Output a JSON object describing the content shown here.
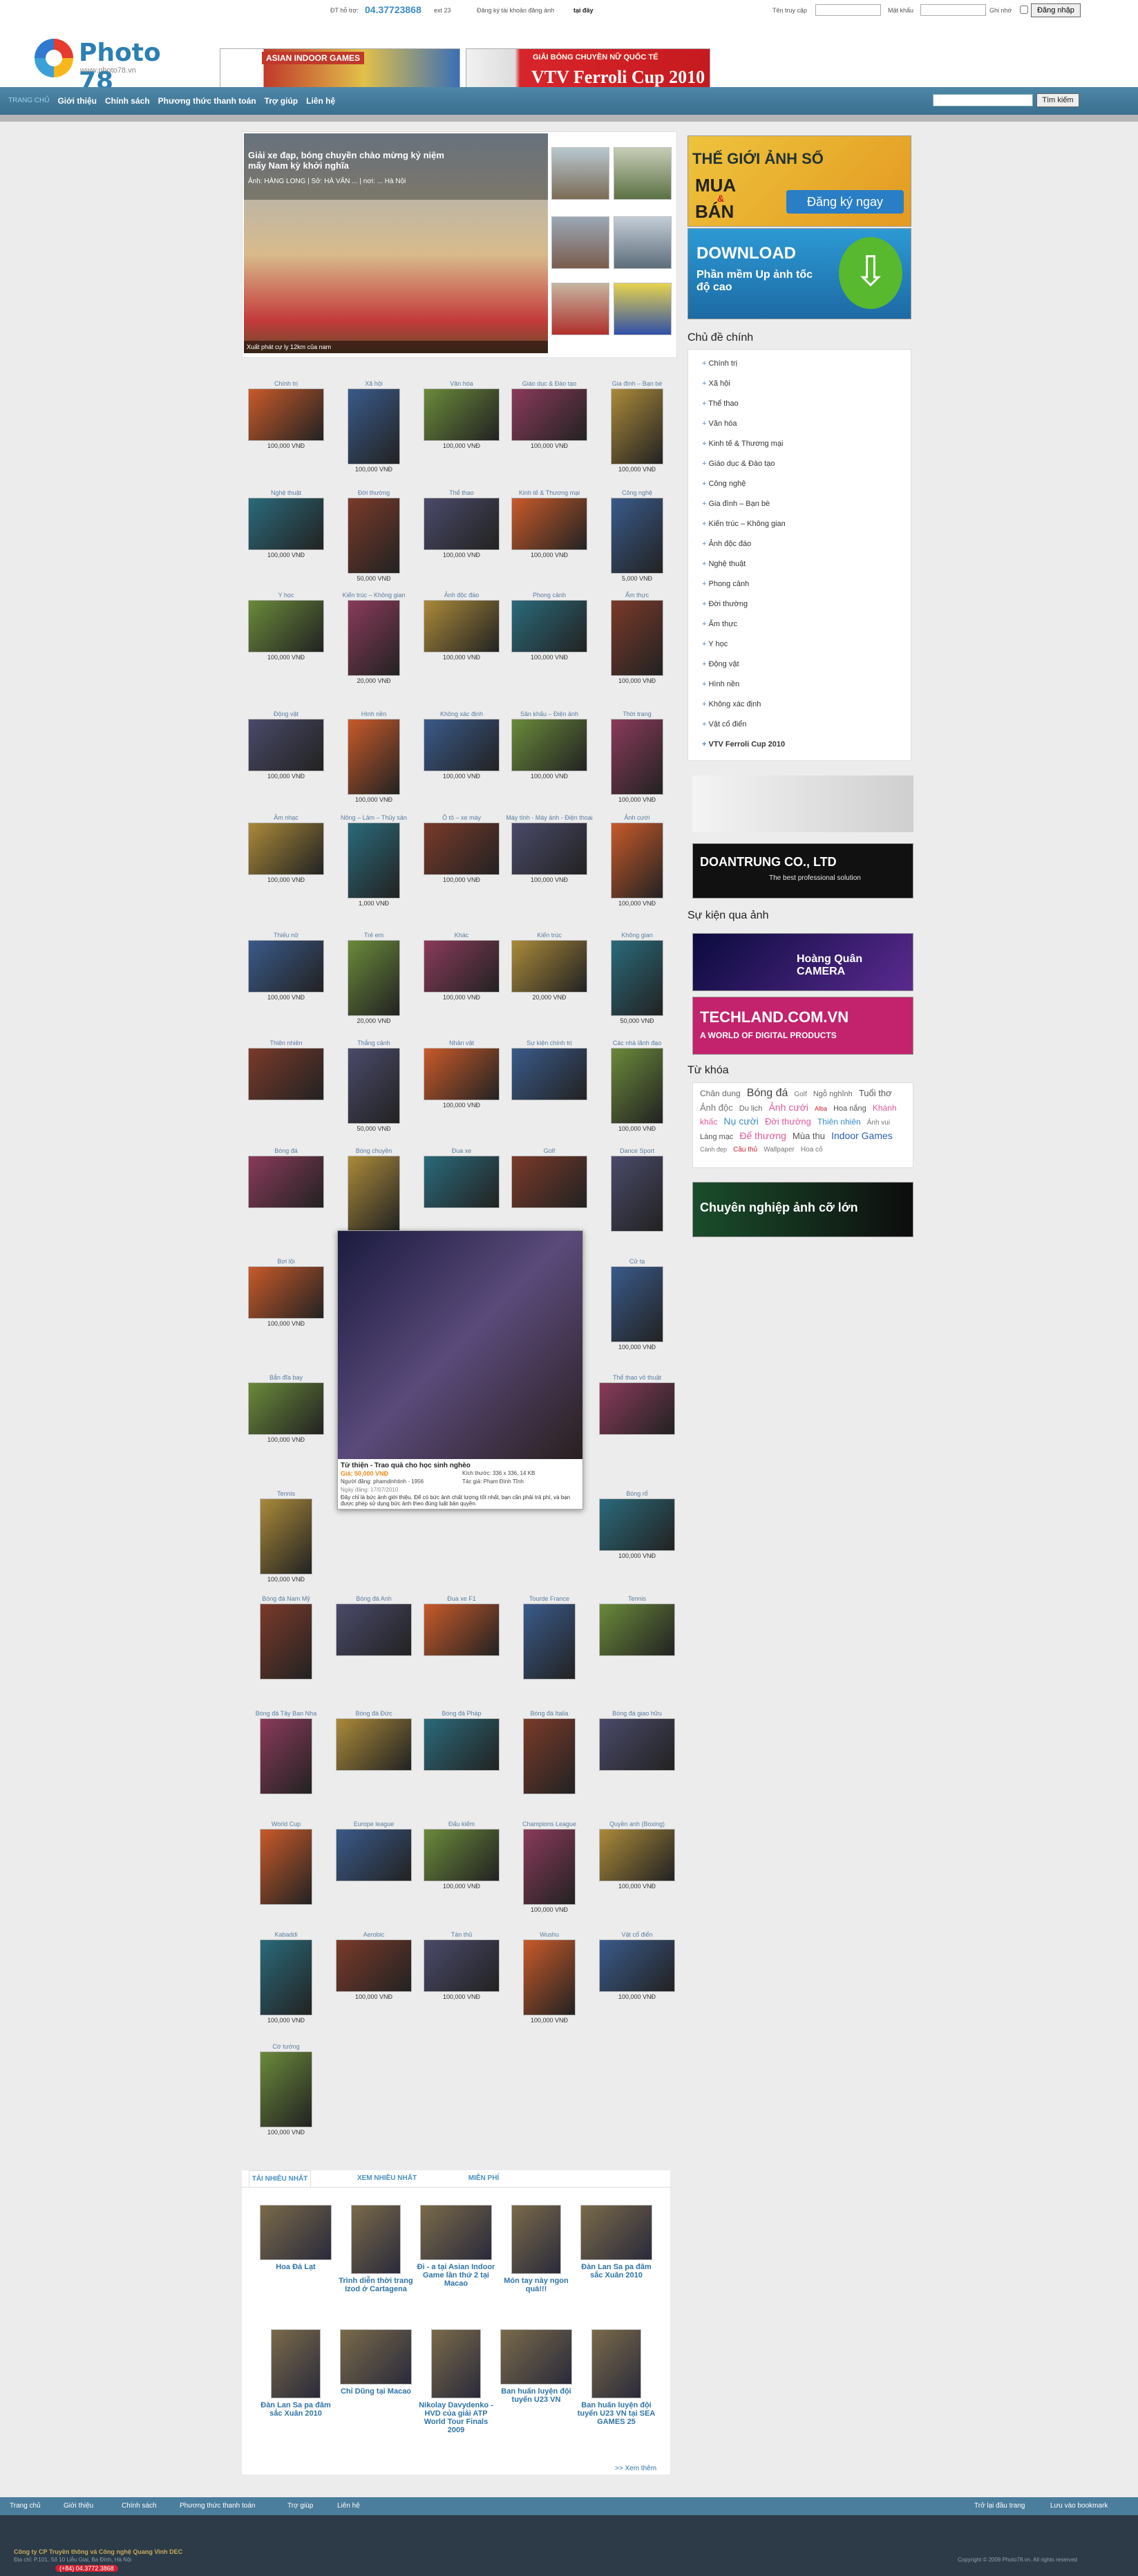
{
  "topbar": {
    "hotline_label": "ĐT hỗ trợ:",
    "hotline": "04.37723868",
    "ext": "ext 23",
    "register": "Đăng ký tài khoản đăng ảnh",
    "register_here": "tại đây",
    "login_label": "Tên truy cập",
    "password_label": "Mật khẩu",
    "remember": "Ghi nhớ",
    "login_button": "Đăng nhập"
  },
  "logo": {
    "name": "Photo 78",
    "url": "www.photo78.vn"
  },
  "banners": {
    "left": "ASIAN INDOOR GAMES",
    "right_top": "GIẢI BÓNG CHUYỀN NỮ QUỐC TẾ",
    "right_main": "VTV Ferroli Cup 2010"
  },
  "nav": {
    "first": "TRANG CHỦ",
    "items": [
      "Giới thiệu",
      "Chính sách",
      "Phương thức thanh toán",
      "Trợ giúp",
      "Liên hệ"
    ],
    "search_button": "Tìm kiếm"
  },
  "featured": {
    "title": "Giải xe đạp, bóng chuyền chào mừng kỷ niệm mấy Nam kỳ khởi nghĩa",
    "sub": "Ảnh: HÀNG LONG | Sở: HÀ VĂN ... | nơi: ... Hà Nội",
    "caption": "Xuất phát cự ly 12km của nam"
  },
  "ads": {
    "world_title": "THẾ GIỚI ẢNH SỐ",
    "buy": "MUA",
    "and": "&",
    "sell": "BÁN",
    "register": "Đăng ký ngay",
    "download": "DOWNLOAD",
    "software": "Phần mềm Up ảnh tốc độ cao",
    "doantrung": "DOANTRUNG CO., LTD",
    "doantrung_sub": "The best professional solution",
    "hoangquan": "Hoàng Quân CAMERA",
    "techland": "TECHLAND.COM.VN",
    "techland_sub": "A WORLD OF DIGITAL PRODUCTS",
    "career": "Chuyên nghiệp ảnh cỡ lớn"
  },
  "sidebar": {
    "topics_title": "Chủ đề chính",
    "topics": [
      "Chính trị",
      "Xã hội",
      "Thể thao",
      "Văn hóa",
      "Kinh tế & Thương mại",
      "Giáo dục & Đào tạo",
      "Công nghệ",
      "Gia đình – Bạn bè",
      "Kiến trúc – Không gian",
      "Ảnh độc đáo",
      "Nghệ thuật",
      "Phong cảnh",
      "Đời thường",
      "Ẩm thực",
      "Y học",
      "Động vật",
      "Hình nền",
      "Không xác định",
      "Vật cổ điển",
      "VTV Ferroli Cup 2010"
    ],
    "events_title": "Sự kiện qua ảnh",
    "tags_title": "Từ khóa",
    "tags": [
      "Chân dung",
      "Bóng đá",
      "Golf",
      "Ngỗ nghĩnh",
      "Tuổi thơ",
      "Ảnh độc",
      "Du lịch",
      "Ảnh cưới",
      "Alba",
      "Hoa nắng",
      "Khánh khấc",
      "Nụ cười",
      "Đời thường",
      "Thiên nhiên",
      "Ảnh vui",
      "Làng mạc",
      "Để thương",
      "Mùa thu",
      "Indoor Games",
      "Cảnh đẹp",
      "Cầu thủ",
      "Wallpaper",
      "Hoa cỏ"
    ]
  },
  "categories": [
    {
      "label": "Chính trị",
      "price": "100,000 VNĐ"
    },
    {
      "label": "Xã hội",
      "price": "100,000 VNĐ"
    },
    {
      "label": "Văn hóa",
      "price": "100,000 VNĐ"
    },
    {
      "label": "Giáo dục & Đào tạo",
      "price": "100,000 VNĐ"
    },
    {
      "label": "Gia đình – Bạn bè",
      "price": "100,000 VNĐ"
    },
    {
      "label": "Nghệ thuật",
      "price": "100,000 VNĐ"
    },
    {
      "label": "Đời thường",
      "price": "50,000 VNĐ"
    },
    {
      "label": "Thể thao",
      "price": "100,000 VNĐ"
    },
    {
      "label": "Kinh tế & Thương mại",
      "price": "100,000 VNĐ"
    },
    {
      "label": "Công nghệ",
      "price": "5,000 VNĐ"
    },
    {
      "label": "Y học",
      "price": "100,000 VNĐ"
    },
    {
      "label": "Kiến trúc – Không gian",
      "price": "20,000 VNĐ"
    },
    {
      "label": "Ảnh độc đáo",
      "price": "100,000 VNĐ"
    },
    {
      "label": "Phong cảnh",
      "price": "100,000 VNĐ"
    },
    {
      "label": "Ẩm thực",
      "price": "100,000 VNĐ"
    },
    {
      "label": "Động vật",
      "price": "100,000 VNĐ"
    },
    {
      "label": "Hình nền",
      "price": "100,000 VNĐ"
    },
    {
      "label": "Không xác định",
      "price": "100,000 VNĐ"
    },
    {
      "label": "Sân khấu – Điện ảnh",
      "price": "100,000 VNĐ"
    },
    {
      "label": "Thời trang",
      "price": "100,000 VNĐ"
    },
    {
      "label": "Âm nhạc",
      "price": "100,000 VNĐ"
    },
    {
      "label": "Nông – Lâm – Thủy sản",
      "price": "1,000 VNĐ"
    },
    {
      "label": "Ô tô – xe máy",
      "price": "100,000 VNĐ"
    },
    {
      "label": "Máy tính - Máy ảnh - Điện thoại",
      "price": "100,000 VNĐ"
    },
    {
      "label": "Ảnh cưới",
      "price": "100,000 VNĐ"
    },
    {
      "label": "Thiếu nữ",
      "price": "100,000 VNĐ"
    },
    {
      "label": "Trẻ em",
      "price": "20,000 VNĐ"
    },
    {
      "label": "Khác",
      "price": "100,000 VNĐ"
    },
    {
      "label": "Kiến trúc",
      "price": "20,000 VNĐ"
    },
    {
      "label": "Không gian",
      "price": "50,000 VNĐ"
    },
    {
      "label": "Thiên nhiên",
      "price": ""
    },
    {
      "label": "Thắng cảnh",
      "price": "50,000 VNĐ"
    },
    {
      "label": "Nhân vật",
      "price": "100,000 VNĐ"
    },
    {
      "label": "Sự kiện chính trị",
      "price": ""
    },
    {
      "label": "Các nhà lãnh đạo",
      "price": "100,000 VNĐ"
    },
    {
      "label": "Bóng đá",
      "price": ""
    },
    {
      "label": "Bóng chuyền",
      "price": ""
    },
    {
      "label": "Đua xe",
      "price": ""
    },
    {
      "label": "Golf",
      "price": ""
    },
    {
      "label": "Dance Sport",
      "price": ""
    },
    {
      "label": "Bơi lội",
      "price": "100,000 VNĐ"
    },
    {
      "label": "Cử tạ",
      "price": "100,000 VNĐ"
    },
    {
      "label": "Bắn đĩa bay",
      "price": "100,000 VNĐ"
    },
    {
      "label": "Thể thao vô thuật",
      "price": ""
    },
    {
      "label": "Tennis",
      "price": "100,000 VNĐ"
    },
    {
      "label": "Bóng rổ",
      "price": "100,000 VNĐ"
    },
    {
      "label": "Bóng đá Nam Mỹ",
      "price": ""
    },
    {
      "label": "Bóng đá Anh",
      "price": ""
    },
    {
      "label": "Đua xe F1",
      "price": ""
    },
    {
      "label": "Tourde France",
      "price": ""
    },
    {
      "label": "Tennis",
      "price": ""
    },
    {
      "label": "Bóng đá Tây Ban Nha",
      "price": ""
    },
    {
      "label": "Bóng đá Đức",
      "price": ""
    },
    {
      "label": "Bóng đá Pháp",
      "price": ""
    },
    {
      "label": "Bóng đá Italia",
      "price": ""
    },
    {
      "label": "Bóng đá giao hữu",
      "price": ""
    },
    {
      "label": "World Cup",
      "price": ""
    },
    {
      "label": "Europe league",
      "price": ""
    },
    {
      "label": "Đấu kiếm",
      "price": "100,000 VNĐ"
    },
    {
      "label": "Champions League",
      "price": "100,000 VNĐ"
    },
    {
      "label": "Quyền anh (Boxing)",
      "price": "100,000 VNĐ"
    },
    {
      "label": "Kabaddi",
      "price": "100,000 VNĐ"
    },
    {
      "label": "Aerobic",
      "price": "100,000 VNĐ"
    },
    {
      "label": "Tán thủ",
      "price": "100,000 VNĐ"
    },
    {
      "label": "Wushu",
      "price": "100,000 VNĐ"
    },
    {
      "label": "Vật cổ điển",
      "price": "100,000 VNĐ"
    },
    {
      "label": "Cờ tướng",
      "price": "100,000 VNĐ"
    }
  ],
  "popup": {
    "title": "Từ thiện - Trao quà cho học sinh nghèo",
    "price": "Giá: 50,000 VNĐ",
    "uploader": "Người đăng: phamdinhtinh - 1956",
    "size": "Kích thước: 336 x 336, 14 KB",
    "date": "Ngày đăng: 17/07/2010",
    "author": "Tác giả: Phạm Đình Tĩnh",
    "desc": "Đây chỉ là bức ảnh giới thiệu. Để có bức ảnh chất lượng tốt nhất, bạn cần phải trả phí, và bạn được phép sử dụng bức ảnh theo đúng luật bản quyền."
  },
  "tabs": {
    "items": [
      "TẢI NHIỀU NHẤT",
      "XEM NHIỀU NHẤT",
      "MIỄN PHÍ"
    ],
    "more": ">> Xem thêm"
  },
  "best": [
    "Hoa Đá Lạt",
    "Trình diễn thời trang Izod ở Cartagena",
    "Đi - a tại Asian Indoor Game lần thứ 2 tại Macao",
    "Món tay này ngon quá!!!",
    "Đàn Lan Sa pa đâm sắc Xuân 2010",
    "Đàn Lan Sa pa đâm sắc Xuân 2010",
    "Chỉ Dũng tại Macao",
    "Nikolay Davydenko - HVD của giải ATP World Tour Finals 2009",
    "Ban huấn luyện đội tuyển U23 VN",
    "Ban huấn luyện đội tuyển U23 VN tại SEA GAMES 25"
  ],
  "footer": {
    "nav": [
      "Trang chủ",
      "Giới thiệu",
      "Chính sách",
      "Phương thức thanh toán",
      "Trợ giúp",
      "Liên hệ"
    ],
    "homepage": "Trở lại đầu trang",
    "bookmark": "Lưu vào bookmark",
    "company": "Công ty CP Truyền thông và Công nghệ Quang Vinh DEC",
    "address": "Địa chỉ: P.101, Số 10 Liễu Giai, Ba Đình, Hà Nội",
    "phone": "(+84) 04.3772.3868",
    "copyright": "Copyright © 2009 Photo78.vn. All rights reserved"
  },
  "colors": {
    "nav": "#3f7596",
    "accent": "#2b7fb3",
    "price": "#333333"
  }
}
